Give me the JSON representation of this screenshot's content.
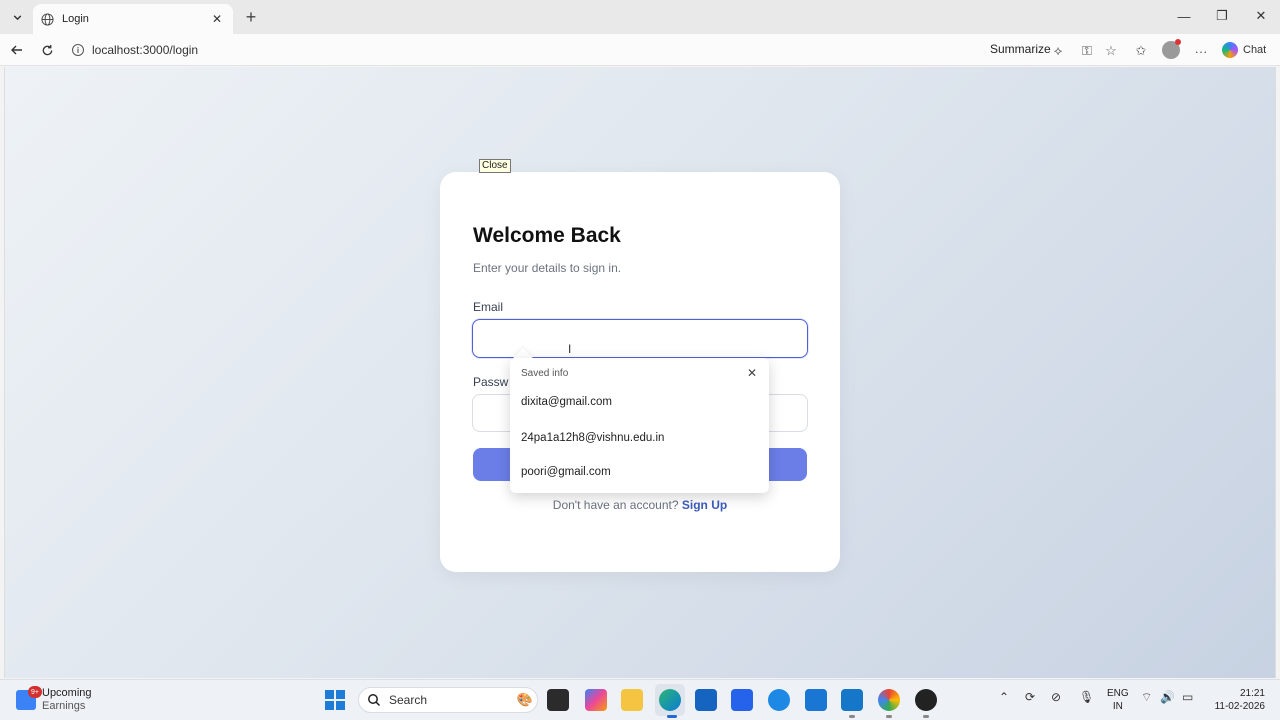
{
  "browser": {
    "tab_title": "Login",
    "url": "localhost:3000/login",
    "summarize_label": "Summarize",
    "chat_label": "Chat"
  },
  "page": {
    "tooltip": "Close",
    "heading": "Welcome Back",
    "subtitle": "Enter your details to sign in.",
    "email_label": "Email",
    "email_value": "",
    "password_label": "Passw",
    "signup_prompt": "Don't have an account?",
    "signup_link": "Sign Up",
    "button_color": "#6b7ee8"
  },
  "autofill": {
    "header": "Saved info",
    "items": [
      "dixita@gmail.com",
      "24pa1a12h8@vishnu.edu.in",
      "poori@gmail.com"
    ]
  },
  "taskbar": {
    "widget_badge": "9+",
    "widget_title": "Upcoming",
    "widget_subtitle": "Earnings",
    "search_label": "Search",
    "lang_top": "ENG",
    "lang_bottom": "IN",
    "time": "21:21",
    "date": "11-02-2026",
    "apps": [
      "file-explorer-icon",
      "copilot-icon",
      "folder-icon",
      "edge-icon",
      "store-icon",
      "teams-icon",
      "sync-icon",
      "photos-icon",
      "vscode-icon",
      "chrome-icon",
      "github-icon"
    ]
  }
}
